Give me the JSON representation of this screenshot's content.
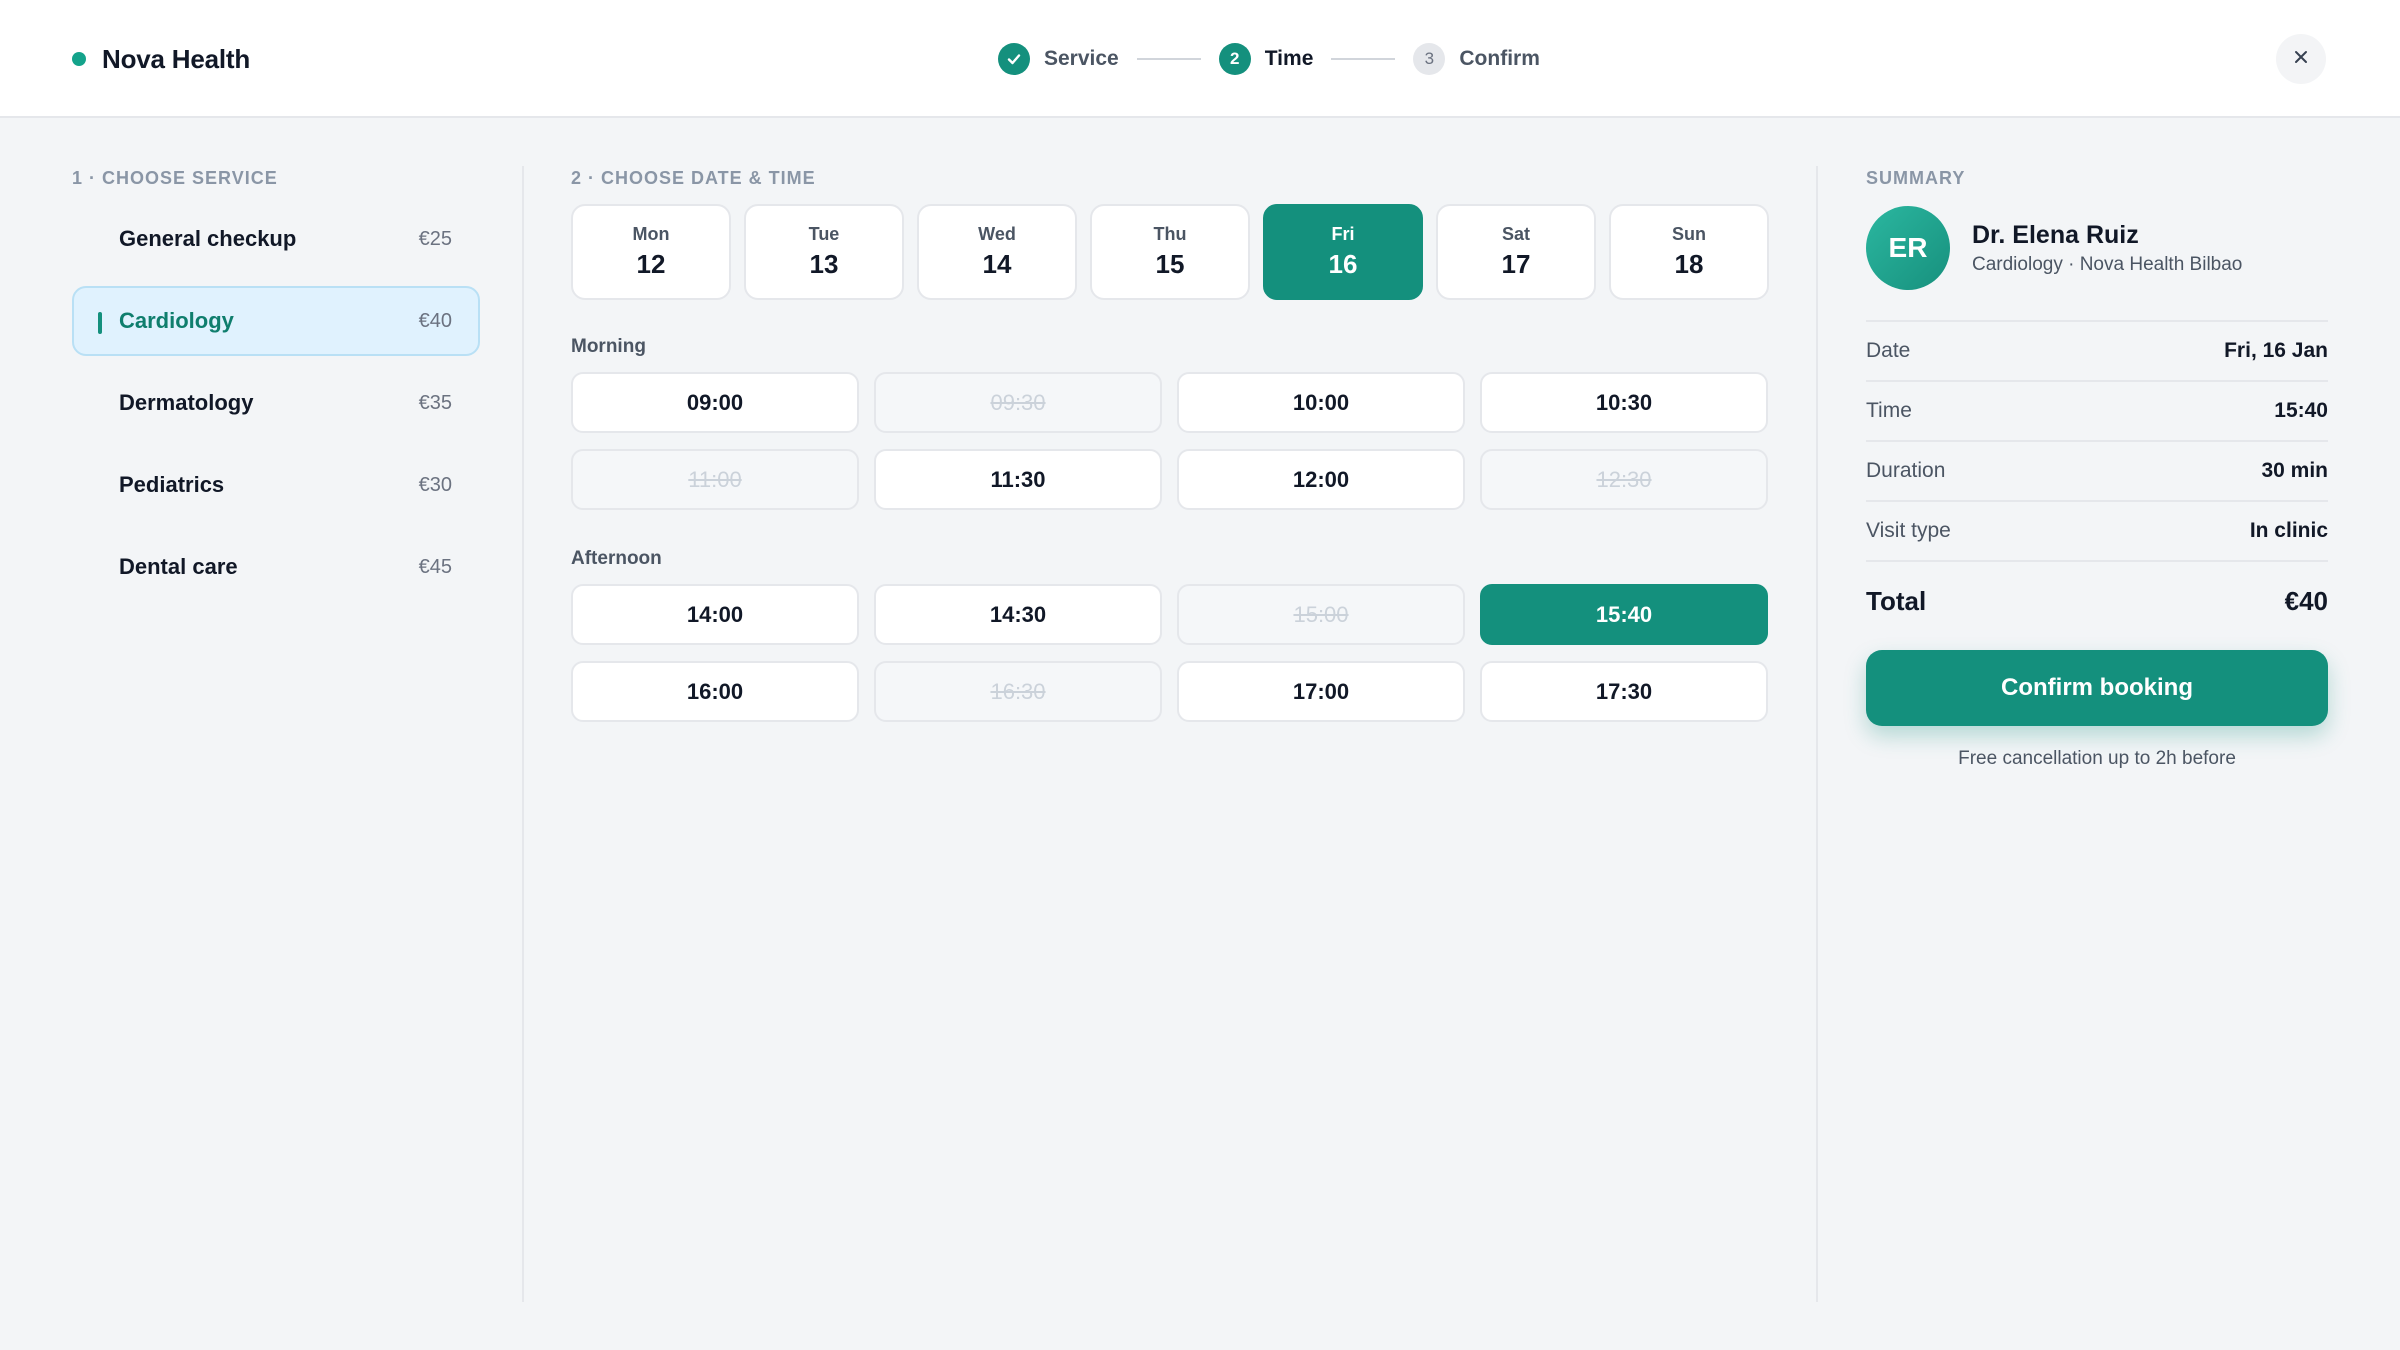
{
  "header": {
    "brand": "Nova Health",
    "steps": [
      {
        "label": "Service",
        "number": "1",
        "state": "done"
      },
      {
        "label": "Time",
        "number": "2",
        "state": "active"
      },
      {
        "label": "Confirm",
        "number": "3",
        "state": "todo"
      }
    ]
  },
  "services": {
    "title": "1 · CHOOSE SERVICE",
    "items": [
      {
        "name": "General checkup",
        "price": "€25",
        "selected": false
      },
      {
        "name": "Cardiology",
        "price": "€40",
        "selected": true
      },
      {
        "name": "Dermatology",
        "price": "€35",
        "selected": false
      },
      {
        "name": "Pediatrics",
        "price": "€30",
        "selected": false
      },
      {
        "name": "Dental care",
        "price": "€45",
        "selected": false
      }
    ]
  },
  "schedule": {
    "title": "2 · CHOOSE DATE & TIME",
    "days": [
      {
        "name": "Mon",
        "num": "12",
        "selected": false
      },
      {
        "name": "Tue",
        "num": "13",
        "selected": false
      },
      {
        "name": "Wed",
        "num": "14",
        "selected": false
      },
      {
        "name": "Thu",
        "num": "15",
        "selected": false
      },
      {
        "name": "Fri",
        "num": "16",
        "selected": true
      },
      {
        "name": "Sat",
        "num": "17",
        "selected": false
      },
      {
        "name": "Sun",
        "num": "18",
        "selected": false
      }
    ],
    "morning": {
      "label": "Morning",
      "slots": [
        {
          "time": "09:00",
          "state": "available"
        },
        {
          "time": "09:30",
          "state": "disabled"
        },
        {
          "time": "10:00",
          "state": "available"
        },
        {
          "time": "10:30",
          "state": "available"
        },
        {
          "time": "11:00",
          "state": "disabled"
        },
        {
          "time": "11:30",
          "state": "available"
        },
        {
          "time": "12:00",
          "state": "available"
        },
        {
          "time": "12:30",
          "state": "disabled"
        }
      ]
    },
    "afternoon": {
      "label": "Afternoon",
      "slots": [
        {
          "time": "14:00",
          "state": "available"
        },
        {
          "time": "14:30",
          "state": "available"
        },
        {
          "time": "15:00",
          "state": "disabled"
        },
        {
          "time": "15:40",
          "state": "selected"
        },
        {
          "time": "16:00",
          "state": "available"
        },
        {
          "time": "16:30",
          "state": "disabled"
        },
        {
          "time": "17:00",
          "state": "available"
        },
        {
          "time": "17:30",
          "state": "available"
        }
      ]
    }
  },
  "summary": {
    "title": "SUMMARY",
    "doctor": {
      "initials": "ER",
      "name": "Dr. Elena Ruiz",
      "subtitle": "Cardiology · Nova Health Bilbao"
    },
    "rows": [
      {
        "key": "Date",
        "value": "Fri, 16 Jan"
      },
      {
        "key": "Time",
        "value": "15:40"
      },
      {
        "key": "Duration",
        "value": "30 min"
      },
      {
        "key": "Visit type",
        "value": "In clinic"
      }
    ],
    "total_label": "Total",
    "total_value": "€40",
    "confirm_label": "Confirm booking",
    "fine_print": "Free cancellation up to 2h before"
  },
  "colors": {
    "accent": "#14907d",
    "selected_service_bg": "#e0f2fe"
  },
  "icons": {
    "close": "close-icon",
    "check": "check-icon"
  }
}
